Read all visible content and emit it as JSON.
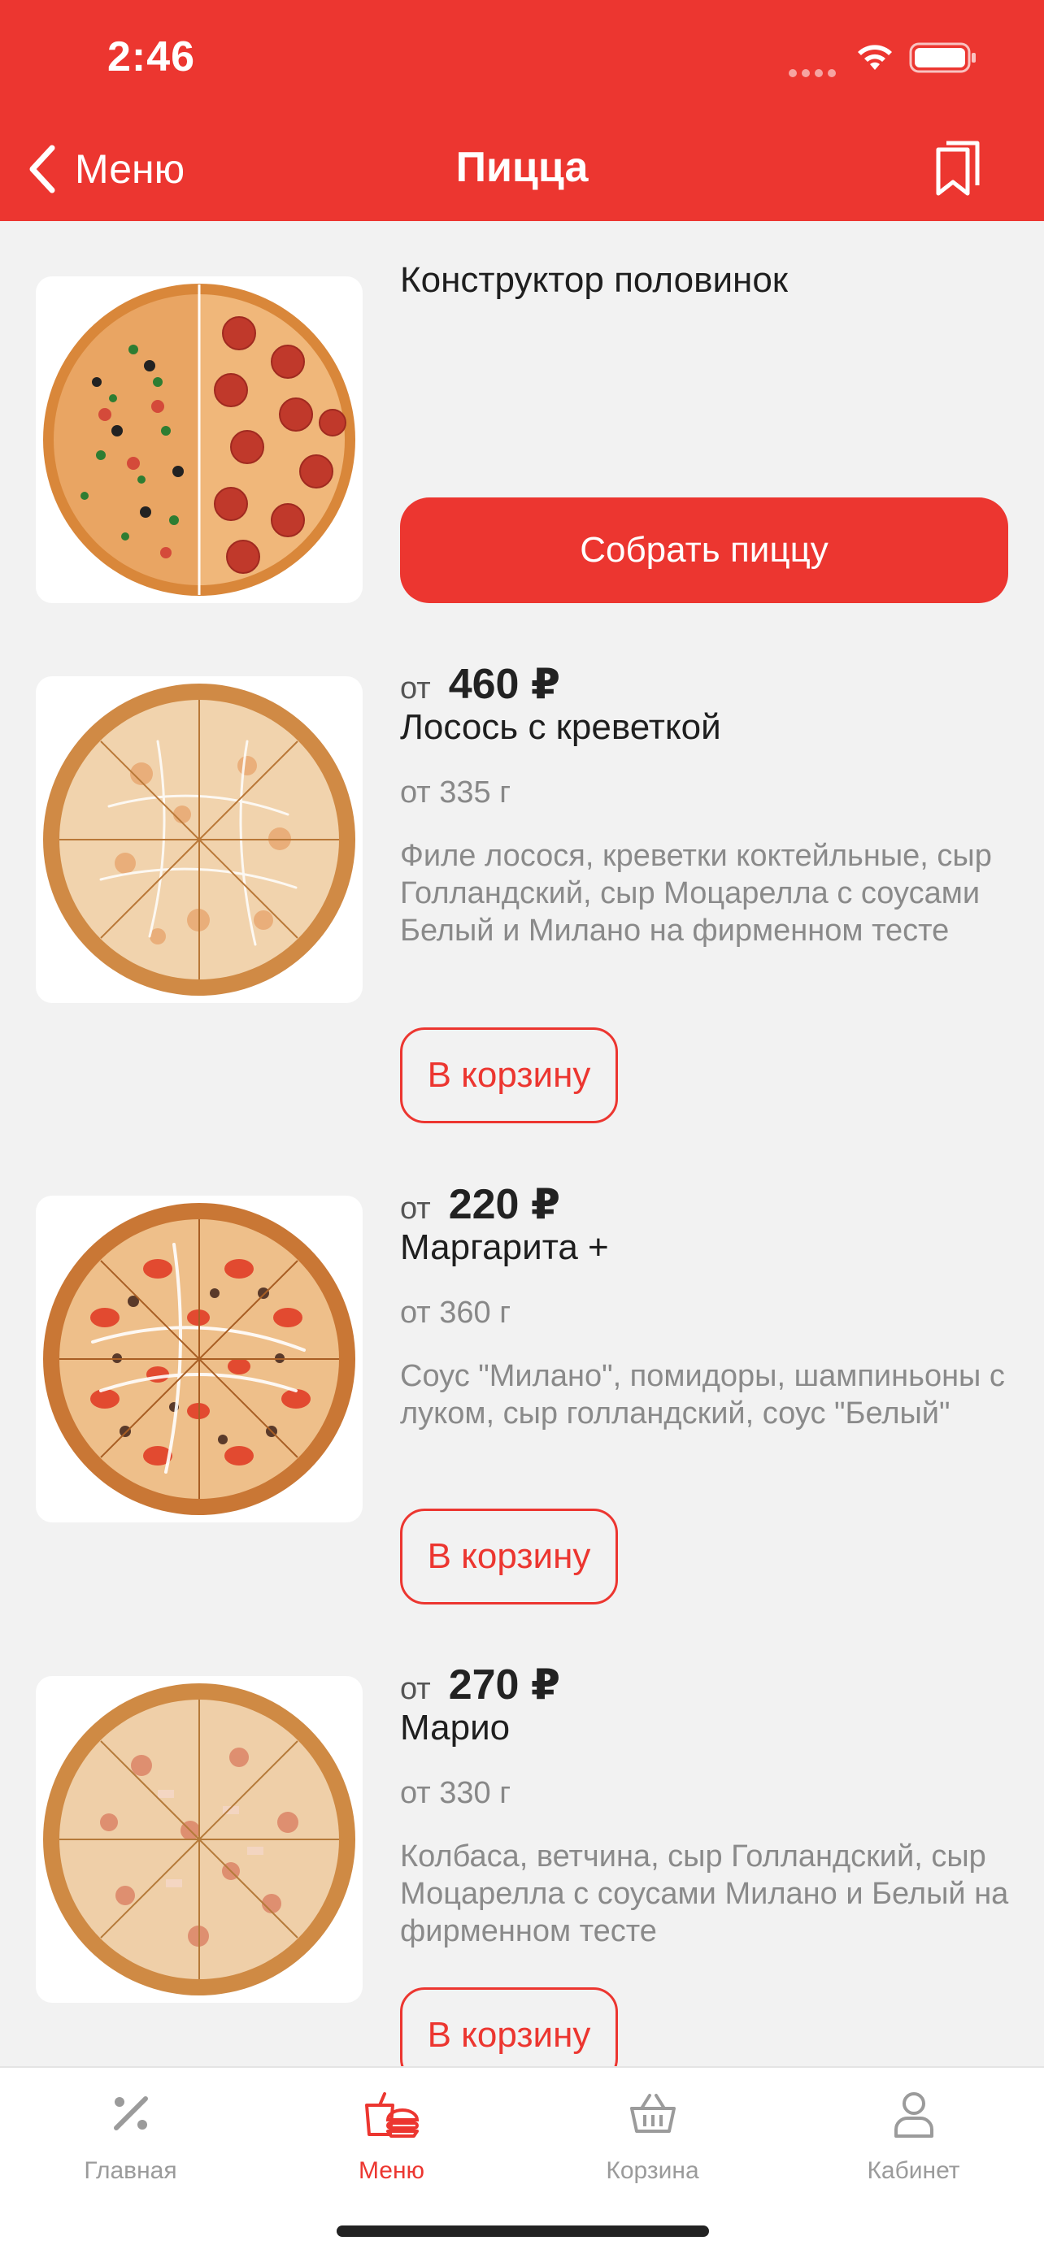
{
  "status_bar": {
    "time": "2:46"
  },
  "header": {
    "back_label": "Меню",
    "title": "Пицца"
  },
  "constructor": {
    "title": "Конструктор половинок",
    "button_label": "Собрать пиццу"
  },
  "items": [
    {
      "price_prefix": "от",
      "price": "460 ₽",
      "name": "Лосось с креветкой",
      "weight": "от 335 г",
      "description": "Филе лосося, креветки коктейльные, сыр Голландский, сыр Моцарелла с соусами Белый и Милано на фирменном тесте",
      "cart_label": "В корзину"
    },
    {
      "price_prefix": "от",
      "price": "220 ₽",
      "name": "Маргарита +",
      "weight": "от 360 г",
      "description": "Соус \"Милано\", помидоры, шампиньоны с луком, сыр голландский, соус \"Белый\"",
      "cart_label": "В корзину"
    },
    {
      "price_prefix": "от",
      "price": "270 ₽",
      "name": "Марио",
      "weight": "от 330 г",
      "description": "Колбаса, ветчина, сыр Голландский, сыр Моцарелла с соусами Милано и Белый на фирменном тесте",
      "cart_label": "В корзину"
    }
  ],
  "tabbar": {
    "tabs": [
      {
        "label": "Главная",
        "icon": "percent-icon",
        "active": false
      },
      {
        "label": "Меню",
        "icon": "food-menu-icon",
        "active": true
      },
      {
        "label": "Корзина",
        "icon": "basket-icon",
        "active": false
      },
      {
        "label": "Кабинет",
        "icon": "user-icon",
        "active": false
      }
    ]
  },
  "colors": {
    "brand_red": "#ec3630",
    "background": "#f2f2f2",
    "inactive_tab": "#9b9b9b"
  }
}
